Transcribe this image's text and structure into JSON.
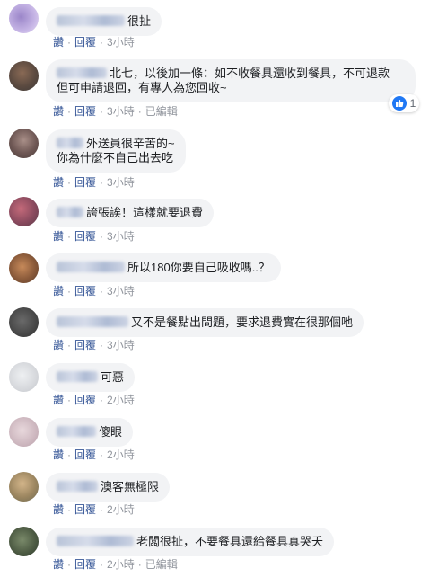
{
  "actions": {
    "like": "讚",
    "reply": "回覆",
    "edited": "已編輯"
  },
  "comments": [
    {
      "text": "很扯",
      "time": "3小時"
    },
    {
      "text": "北七，以後加一條：如不收餐具還收到餐具，不可退款",
      "text2": "但可申請退回，有專人為您回收~",
      "time": "3小時",
      "edited": true,
      "reactions": "1",
      "reaction_icon": "like-thumb-icon"
    },
    {
      "text": "外送員很辛苦的~",
      "text2": "你為什麼不自己出去吃",
      "time": "3小時"
    },
    {
      "text": "誇張誒！這樣就要退費",
      "time": "3小時"
    },
    {
      "text": "所以180你要自己吸收嗎..？",
      "time": "3小時"
    },
    {
      "text": "又不是餐點出問題，要求退費實在很那個吔",
      "time": "3小時"
    },
    {
      "text": "可惡",
      "time": "2小時"
    },
    {
      "text": "傻眼",
      "time": "2小時"
    },
    {
      "text": "澳客無極限",
      "time": "2小時"
    },
    {
      "text": "老闆很扯，不要餐具還給餐具真哭夭",
      "time": "2小時",
      "edited": true
    }
  ],
  "colors": {
    "link": "#385898",
    "bubble": "#f2f3f5",
    "meta": "#90949c",
    "like": "#2078f4"
  }
}
